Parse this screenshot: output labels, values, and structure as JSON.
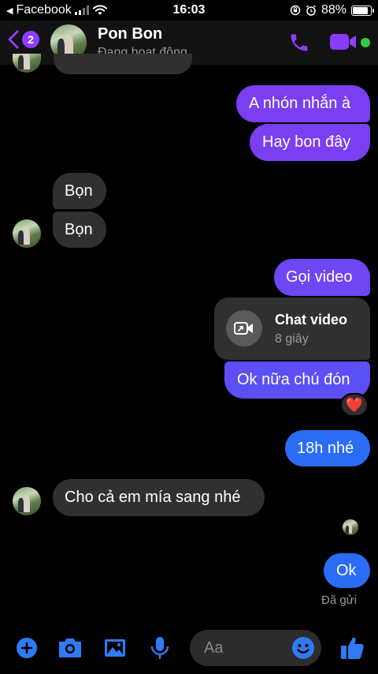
{
  "status_bar": {
    "back_app": "Facebook",
    "time": "16:03",
    "battery": "88%",
    "battery_level": 0.88
  },
  "header": {
    "back_badge": "2",
    "contact_name": "Pon Bon",
    "contact_status": "Đang hoạt động"
  },
  "messages": [
    {
      "text": "A nhón nhắn à",
      "from": "me"
    },
    {
      "text": "Hay bon đây",
      "from": "me"
    },
    {
      "text": "Bọn",
      "from": "them"
    },
    {
      "text": "Bọn",
      "from": "them"
    },
    {
      "text": "Gọi video",
      "from": "me"
    },
    {
      "text": "Ok nữa chú đón",
      "from": "me"
    },
    {
      "text": "18h nhé",
      "from": "me"
    },
    {
      "text": "Cho cả em mía sang nhé",
      "from": "them"
    },
    {
      "text": "Ok",
      "from": "me"
    }
  ],
  "video_call": {
    "title": "Chat video",
    "duration": "8 giây",
    "icon": "video-call-icon"
  },
  "reaction": {
    "emoji": "❤️"
  },
  "sent_status": "Đã gửi",
  "composer": {
    "placeholder": "Aa",
    "icons": [
      "plus-icon",
      "camera-icon",
      "image-icon",
      "microphone-icon",
      "emoji-icon",
      "thumbs-up-icon"
    ]
  },
  "colors": {
    "accent": "#8b3dff",
    "outgoing_purple": "#7b3ff2",
    "outgoing_blue": "#2a6cf6",
    "incoming": "#303030",
    "composer_blue": "#2f7bf5",
    "online": "#31cc46"
  }
}
